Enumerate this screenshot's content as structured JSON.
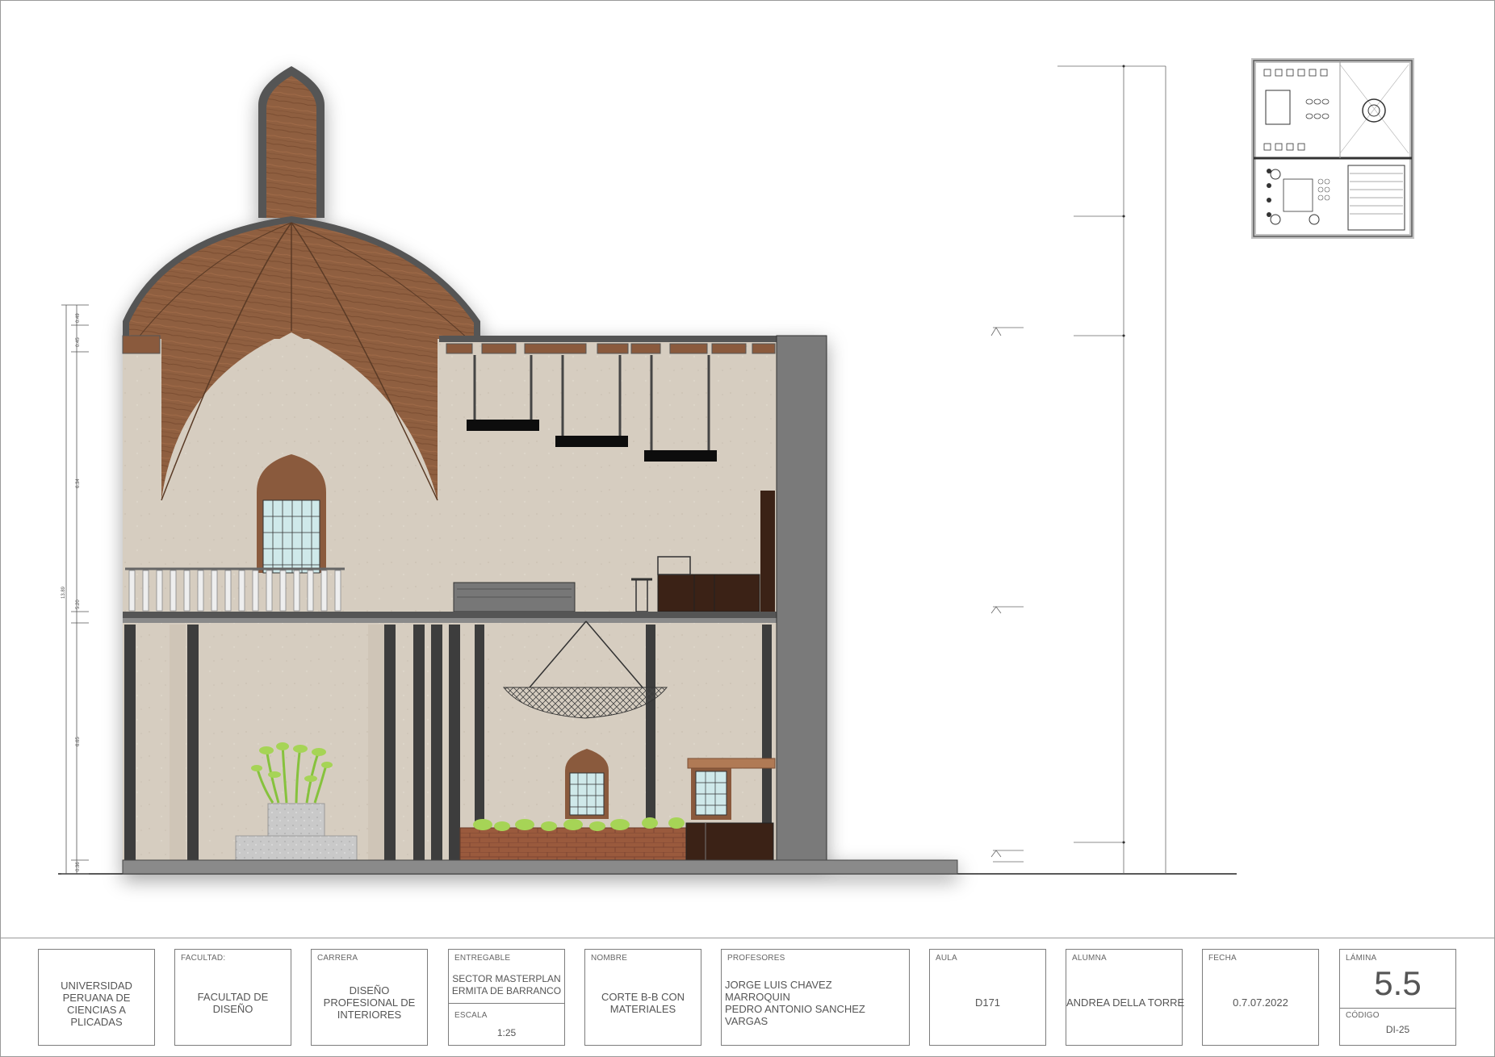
{
  "elevation_dimensions": {
    "total": "13.89",
    "segments": [
      "0.49",
      "0.45",
      "6.34",
      "5.20",
      "6.65",
      "0.36"
    ]
  },
  "title_block": {
    "university": "UNIVERSIDAD\nPERUANA DE\nCIENCIAS A\nPLICADAS",
    "facultad": {
      "label": "FACULTAD:",
      "value": "FACULTAD DE\nDISEÑO"
    },
    "carrera": {
      "label": "CARRERA",
      "value": "DISEÑO\nPROFESIONAL DE\nINTERIORES"
    },
    "entregable": {
      "label": "ENTREGABLE",
      "value": "SECTOR MASTERPLAN\nERMITA DE BARRANCO"
    },
    "escala": {
      "label": "ESCALA",
      "value": "1:25"
    },
    "nombre": {
      "label": "NOMBRE",
      "value": "CORTE B-B CON\nMATERIALES"
    },
    "profesores": {
      "label": "PROFESORES",
      "value": "JORGE LUIS CHAVEZ\nMARROQUIN\nPEDRO ANTONIO SANCHEZ\nVARGAS"
    },
    "aula": {
      "label": "AULA",
      "value": "D171"
    },
    "alumna": {
      "label": "ALUMNA",
      "value": "ANDREA DELLA TORRE"
    },
    "fecha": {
      "label": "FECHA",
      "value": "0.7.07.2022"
    },
    "lamina": {
      "label": "LÁMINA",
      "value": "5.5"
    },
    "codigo": {
      "label": "CÓDIGO",
      "value": "DI-25"
    }
  },
  "colors": {
    "wood": "#8a5a3c",
    "plaster": "#d8cfc2",
    "wall_section": "#7a7a7a",
    "column": "#3a3a3a",
    "glass": "#cfe9ea",
    "plants": "#9bcf4a"
  }
}
